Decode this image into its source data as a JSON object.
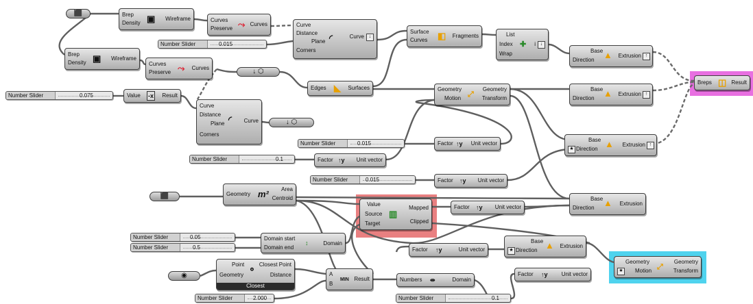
{
  "canvas": {
    "background": "#ffffff",
    "highlights": {
      "pink": "#e86fe1",
      "red": "#e98081",
      "cyan": "#4fd3ee"
    }
  },
  "brep1": {
    "in1": "Brep",
    "in2": "Density",
    "out": "Wireframe"
  },
  "brep2": {
    "in1": "Brep",
    "in2": "Density",
    "out": "Wireframe"
  },
  "curves1": {
    "in1": "Curves",
    "in2": "Preserve",
    "out": "Curves"
  },
  "curves2": {
    "in1": "Curves",
    "in2": "Preserve",
    "out": "Curves"
  },
  "offset1": {
    "in1": "Curve",
    "in2": "Distance",
    "in3": "Plane",
    "in4": "Corners",
    "out": "Curve"
  },
  "offset2": {
    "in1": "Curve",
    "in2": "Distance",
    "in3": "Plane",
    "in4": "Corners",
    "out": "Curve"
  },
  "fragments": {
    "in1": "Surface",
    "in2": "Curves",
    "out": "Fragments"
  },
  "list": {
    "in1": "List",
    "in2": "Index",
    "in3": "Wrap",
    "out": "i"
  },
  "extr1": {
    "in1": "Base",
    "in2": "Direction",
    "out": "Extrusion"
  },
  "extr2": {
    "in1": "Base",
    "in2": "Direction",
    "out": "Extrusion"
  },
  "extr3": {
    "in1": "Base",
    "in2": "Direction",
    "out": "Extrusion"
  },
  "extr4": {
    "in1": "Base",
    "in2": "Direction",
    "out": "Extrusion"
  },
  "extr5": {
    "in1": "Base",
    "in2": "Direction",
    "out": "Extrusion"
  },
  "merge": {
    "in1": "Breps",
    "out": "Result"
  },
  "value": {
    "in1": "Value",
    "out": "Result"
  },
  "edges": {
    "in1": "Edges",
    "out": "Surfaces"
  },
  "move1": {
    "in1": "Geometry",
    "in2": "Motion",
    "out1": "Geometry",
    "out2": "Transform"
  },
  "move2": {
    "in1": "Geometry",
    "in2": "Motion",
    "out1": "Geometry",
    "out2": "Transform"
  },
  "uv1": {
    "in1": "Factor",
    "out": "Unit vector"
  },
  "uv2": {
    "in1": "Factor",
    "out": "Unit vector"
  },
  "uv3": {
    "in1": "Factor",
    "out": "Unit vector"
  },
  "uv4": {
    "in1": "Factor",
    "out": "Unit vector"
  },
  "uv5": {
    "in1": "Factor",
    "out": "Unit vector"
  },
  "uv6": {
    "in1": "Factor",
    "out": "Unit vector"
  },
  "area": {
    "in1": "Geometry",
    "out1": "Area",
    "out2": "Centroid"
  },
  "remap": {
    "in1": "Value",
    "in2": "Source",
    "in3": "Target",
    "out1": "Mapped",
    "out2": "Clipped"
  },
  "domain": {
    "in1": "Domain start",
    "in2": "Domain end",
    "out": "Domain"
  },
  "closest": {
    "in1": "Point",
    "in2": "Geometry",
    "out1": "Closest Point",
    "out2": "Distance",
    "footer": "Closest"
  },
  "minnode": {
    "in1": "A",
    "in2": "B",
    "out": "Result"
  },
  "bounds": {
    "in1": "Numbers",
    "out": "Domain"
  },
  "sliders": {
    "s1": {
      "label": "Number Slider",
      "value": "0.015"
    },
    "s2": {
      "label": "Number Slider",
      "value": "0.075"
    },
    "s3": {
      "label": "Number Slider",
      "value": "0.015"
    },
    "s4": {
      "label": "Number Slider",
      "value": "0.1"
    },
    "s5": {
      "label": "Number Slider",
      "value": "0.015"
    },
    "s6": {
      "label": "Number Slider",
      "value": "0.05"
    },
    "s7": {
      "label": "Number Slider",
      "value": "0.5"
    },
    "s8": {
      "label": "Number Slider",
      "value": "2.000"
    },
    "s9": {
      "label": "Number Slider",
      "value": "0.1"
    }
  }
}
